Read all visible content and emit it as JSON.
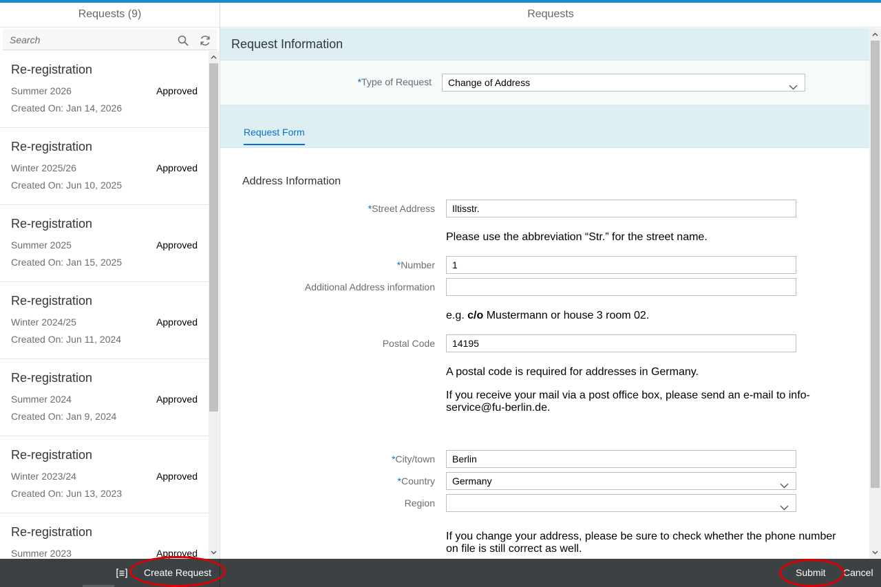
{
  "master": {
    "title": "Requests (9)",
    "search_placeholder": "Search",
    "items": [
      {
        "title": "Re-registration",
        "semester": "Summer 2026",
        "status": "Approved",
        "created": "Created On: Jan 14, 2026"
      },
      {
        "title": "Re-registration",
        "semester": "Winter 2025/26",
        "status": "Approved",
        "created": "Created On: Jun 10, 2025"
      },
      {
        "title": "Re-registration",
        "semester": "Summer 2025",
        "status": "Approved",
        "created": "Created On: Jan 15, 2025"
      },
      {
        "title": "Re-registration",
        "semester": "Winter 2024/25",
        "status": "Approved",
        "created": "Created On: Jun 11, 2024"
      },
      {
        "title": "Re-registration",
        "semester": "Summer 2024",
        "status": "Approved",
        "created": "Created On: Jan 9, 2024"
      },
      {
        "title": "Re-registration",
        "semester": "Winter 2023/24",
        "status": "Approved",
        "created": "Created On: Jun 13, 2023"
      },
      {
        "title": "Re-registration",
        "semester": "Summer 2023",
        "status": "Approved",
        "created": ""
      }
    ]
  },
  "detail": {
    "title": "Requests",
    "section_title": "Request Information",
    "type_label": "Type of Request",
    "type_value": "Change of Address",
    "tab_label": "Request Form",
    "group_title": "Address Information",
    "street_label": "Street Address",
    "street_value": "Iltisstr.",
    "street_hint": "Please use the abbreviation “Str.” for the street name.",
    "number_label": "Number",
    "number_value": "1",
    "additional_label": "Additional Address information",
    "additional_value": "",
    "additional_hint_pre": "e.g. ",
    "additional_hint_bold": "c/o",
    "additional_hint_post": " Mustermann or  house 3 room 02.",
    "postal_label": "Postal Code",
    "postal_value": "14195",
    "postal_hint1": "A postal code is required for addresses in Germany.",
    "postal_hint2": "If you receive your mail via a post office box, please send an e-mail to info-service@fu-berlin.de.",
    "city_label": "City/town",
    "city_value": "Berlin",
    "country_label": "Country",
    "country_value": "Germany",
    "region_label": "Region",
    "region_value": "",
    "phone_hint": "If you change your address, please be sure to check whether the phone number on file is still correct as well.",
    "required_mark": "*"
  },
  "footer": {
    "create_label": "Create Request",
    "submit_label": "Submit",
    "cancel_label": "Cancel"
  },
  "colors": {
    "accent": "#0a6ed1",
    "top_line": "#1b8acb",
    "footer_bg": "#3c4144",
    "highlight_ring": "#e00000"
  }
}
